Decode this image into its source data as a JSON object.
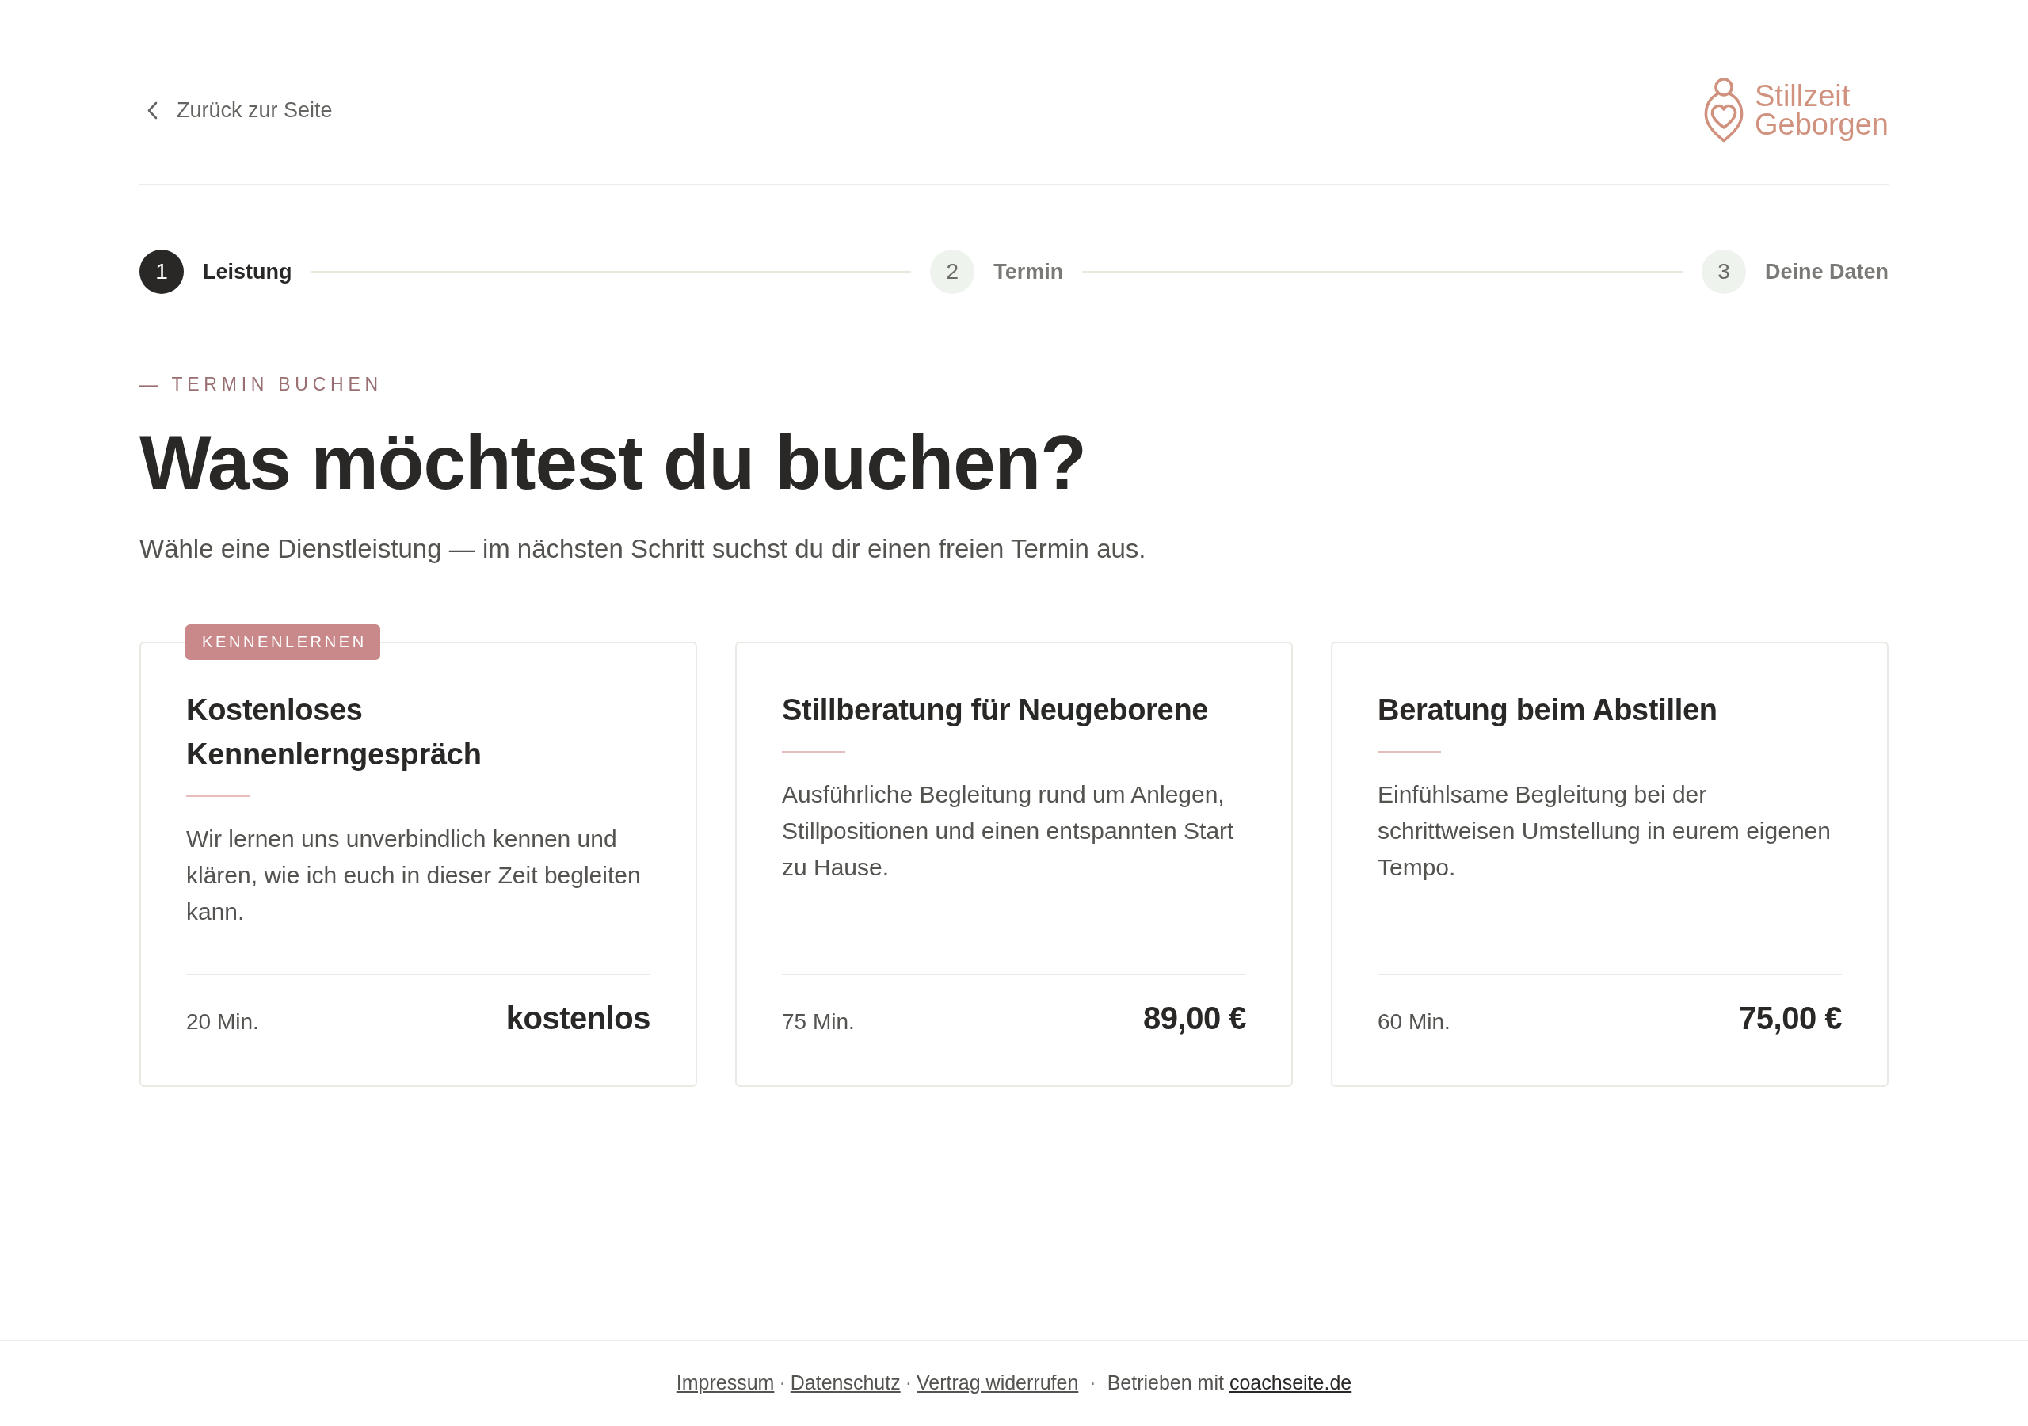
{
  "header": {
    "back_link": "Zurück zur Seite",
    "logo": {
      "line_1": "Stillzeit",
      "line_2": "Geborgen"
    }
  },
  "steps": [
    {
      "number": "1",
      "label": "Leistung",
      "selected": true
    },
    {
      "number": "2",
      "label": "Termin",
      "selected": false
    },
    {
      "number": "3",
      "label": "Deine Daten",
      "selected": false
    }
  ],
  "eyebrow": "— TERMIN BUCHEN",
  "title": "Was möchtest du buchen?",
  "subtitle": "Wähle eine Dienstleistung — im nächsten Schritt suchst du dir einen freien Termin aus.",
  "services": [
    {
      "badge": "KENNENLERNEN",
      "title": "Kostenloses Kennenlerngespräch",
      "description": "Wir lernen uns unverbindlich kennen und klären, wie ich euch in dieser Zeit begleiten kann.",
      "duration": "20 Min.",
      "price": "kostenlos"
    },
    {
      "title": "Stillberatung für Neugeborene",
      "description": "Ausführliche Begleitung rund um Anlegen, Stillpositionen und einen entspannten Start zu Hause.",
      "duration": "75 Min.",
      "price": "89,00 €"
    },
    {
      "title": "Beratung beim Abstillen",
      "description": "Einfühlsame Begleitung bei der schrittweisen Umstellung in eurem eigenen Tempo.",
      "duration": "60 Min.",
      "price": "75,00 €"
    }
  ],
  "footer": {
    "items": [
      {
        "kind": "link",
        "text": "Impressum"
      },
      {
        "kind": "dot",
        "text": "·"
      },
      {
        "kind": "link",
        "text": "Datenschutz"
      },
      {
        "kind": "dot",
        "text": "·"
      },
      {
        "kind": "link",
        "text": "Vertrag widerrufen"
      },
      {
        "kind": "wide_dot",
        "text": "·"
      },
      {
        "kind": "text",
        "text": "Betrieben mit"
      },
      {
        "kind": "brand_link",
        "text": "coachseite.de"
      }
    ]
  }
}
